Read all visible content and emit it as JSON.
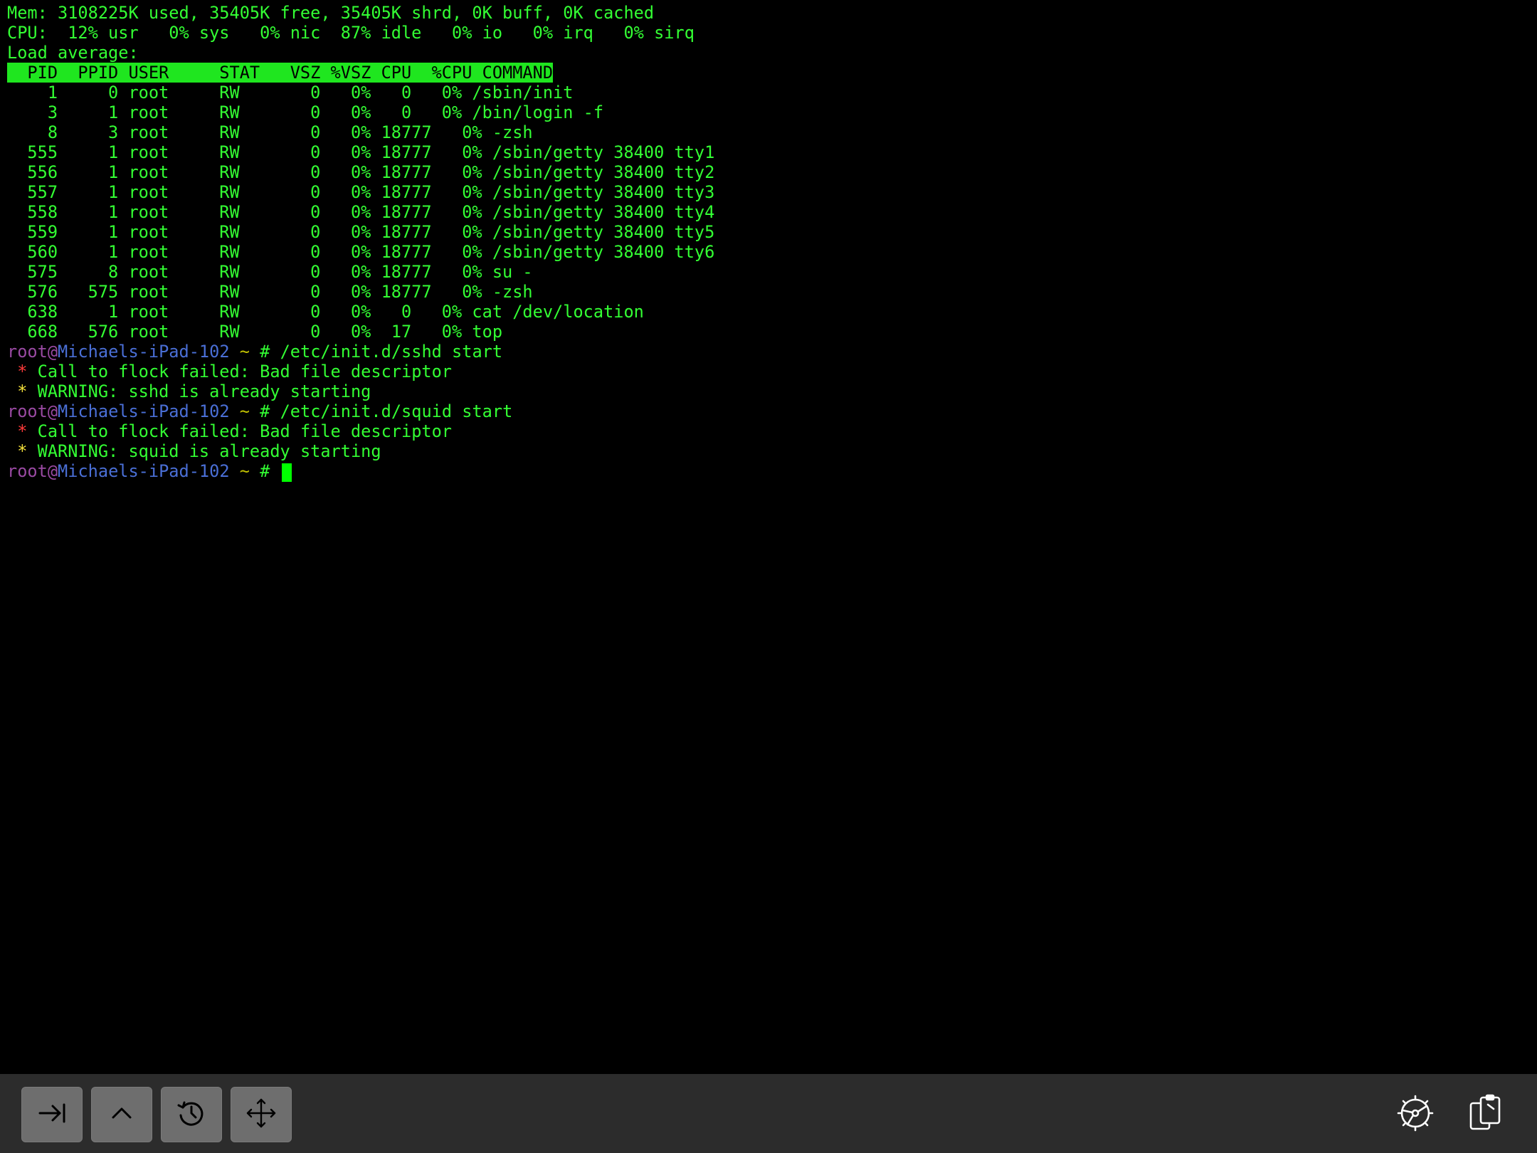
{
  "terminal": {
    "summary": {
      "mem": "Mem: 3108225K used, 35405K free, 35405K shrd, 0K buff, 0K cached",
      "cpu": "CPU:  12% usr   0% sys   0% nic  87% idle   0% io   0% irq   0% sirq",
      "load": "Load average:"
    },
    "header": "  PID  PPID USER     STAT   VSZ %VSZ CPU  %CPU COMMAND",
    "processes": [
      "    1     0 root     RW       0   0%   0   0% /sbin/init",
      "    3     1 root     RW       0   0%   0   0% /bin/login -f",
      "    8     3 root     RW       0   0% 18777   0% -zsh",
      "  555     1 root     RW       0   0% 18777   0% /sbin/getty 38400 tty1",
      "  556     1 root     RW       0   0% 18777   0% /sbin/getty 38400 tty2",
      "  557     1 root     RW       0   0% 18777   0% /sbin/getty 38400 tty3",
      "  558     1 root     RW       0   0% 18777   0% /sbin/getty 38400 tty4",
      "  559     1 root     RW       0   0% 18777   0% /sbin/getty 38400 tty5",
      "  560     1 root     RW       0   0% 18777   0% /sbin/getty 38400 tty6",
      "  575     8 root     RW       0   0% 18777   0% su -",
      "  576   575 root     RW       0   0% 18777   0% -zsh",
      "  638     1 root     RW       0   0%   0   0% cat /dev/location",
      "  668   576 root     RW       0   0%  17   0% top"
    ],
    "prompt": {
      "user": "root",
      "at": "@",
      "host": "Michaels-iPad-102",
      "tilde": " ~",
      "hash": " # "
    },
    "commands": {
      "sshd_cmd": "/etc/init.d/sshd start",
      "sshd_err": "Call to flock failed: Bad file descriptor",
      "sshd_warn": "WARNING: sshd is already starting",
      "squid_cmd": "/etc/init.d/squid start",
      "squid_err": "Call to flock failed: Bad file descriptor",
      "squid_warn": "WARNING: squid is already starting"
    },
    "bullet": " * "
  },
  "toolbar": {
    "buttons": [
      "tab-key-icon",
      "up-arrow-icon",
      "history-icon",
      "move-arrows-icon"
    ],
    "right": [
      "gear-icon",
      "clipboard-icon"
    ]
  },
  "colors": {
    "background": "#000000",
    "text": "#33ff33",
    "header_bg": "#1fe61f",
    "toolbar": "#2c2c2c",
    "button": "#6e6e6e"
  }
}
